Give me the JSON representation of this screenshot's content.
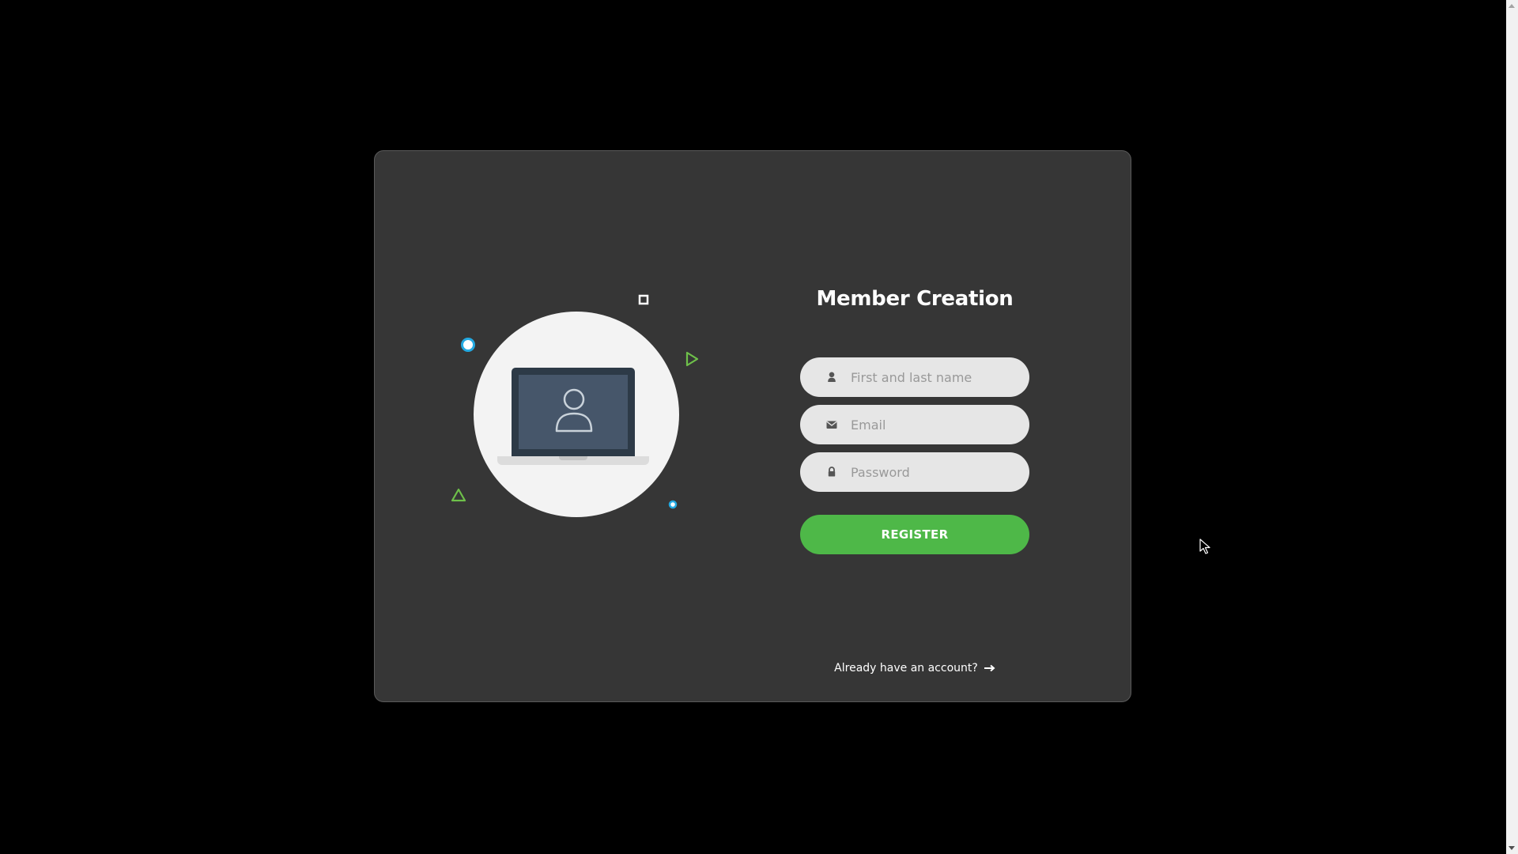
{
  "form": {
    "title": "Member Creation",
    "name_placeholder": "First and last name",
    "email_placeholder": "Email",
    "password_placeholder": "Password",
    "register_label": "REGISTER",
    "signin_label": "Already have an account?"
  },
  "icons": {
    "name_field": "user-icon",
    "email_field": "envelope-icon",
    "password_field": "lock-icon",
    "signin_arrow": "long-arrow-right-icon",
    "illustration": "laptop-user-icon"
  },
  "colors": {
    "background": "#000000",
    "card": "#363636",
    "accent_green": "#4eb848",
    "accent_blue": "#23a9e1",
    "field_bg": "#e6e6e6"
  }
}
